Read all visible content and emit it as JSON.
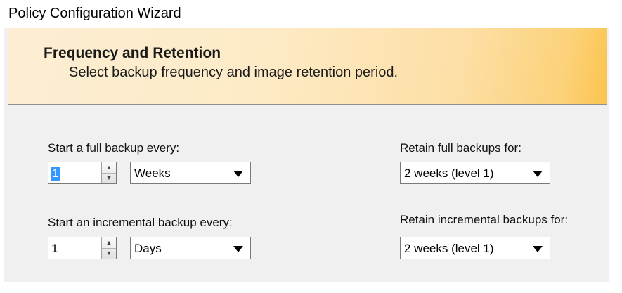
{
  "window": {
    "title": "Policy Configuration Wizard"
  },
  "banner": {
    "title": "Frequency and Retention",
    "subtitle": "Select backup frequency and image retention period."
  },
  "full_backup": {
    "label": "Start a full backup every:",
    "count": "1",
    "unit": "Weeks"
  },
  "incremental_backup": {
    "label": "Start an incremental backup every:",
    "count": "1",
    "unit": "Days"
  },
  "retain_full": {
    "label": "Retain full backups for:",
    "value": "2 weeks (level 1)"
  },
  "retain_incremental": {
    "label": "Retain incremental backups for:",
    "value": "2 weeks (level 1)"
  },
  "icons": {
    "spin_up": "spin-up-icon",
    "spin_down": "spin-down-icon",
    "dropdown": "chevron-down-icon"
  },
  "colors": {
    "selection": "#3399ff",
    "banner_light": "#fdeed3",
    "banner_dark": "#fbc44f"
  }
}
